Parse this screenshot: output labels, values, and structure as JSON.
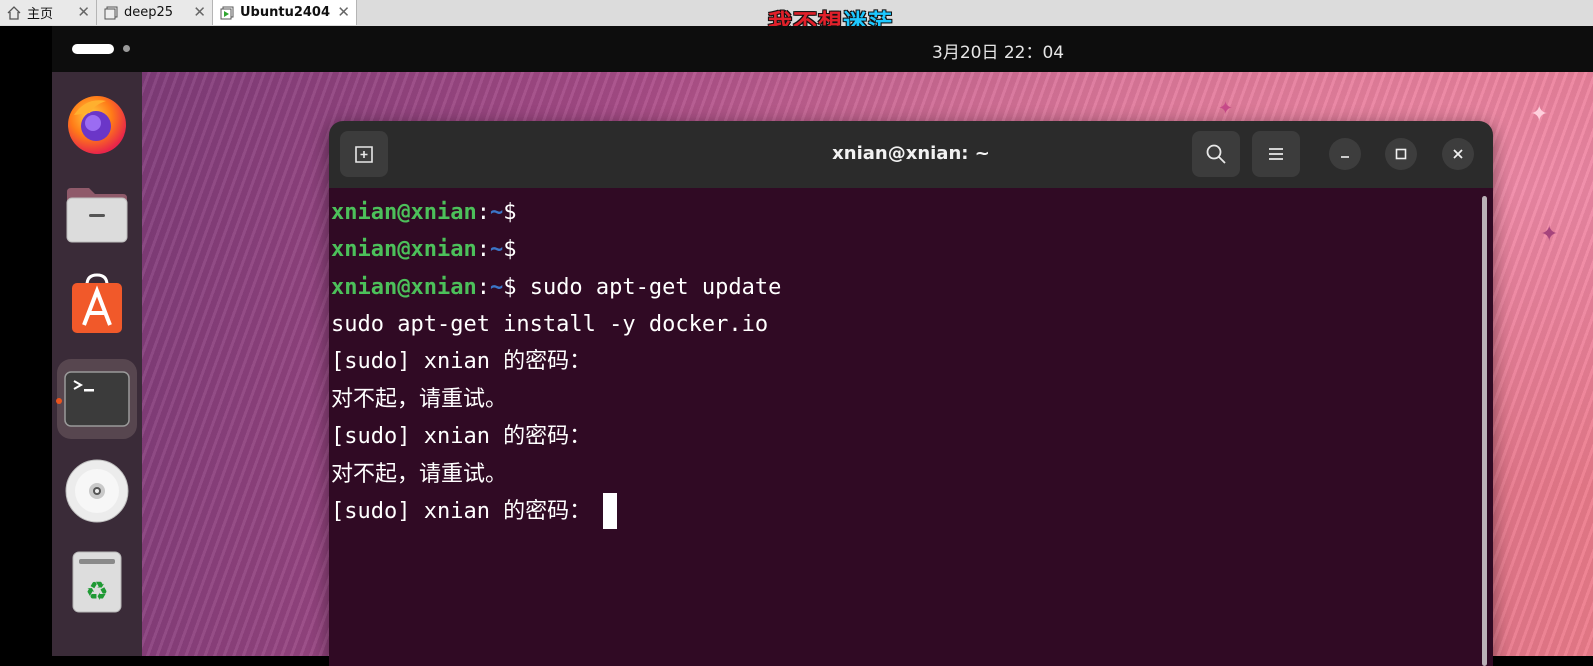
{
  "vm_tabs": [
    {
      "label": "主页",
      "icon": "home-icon"
    },
    {
      "label": "deep25",
      "icon": "vm-icon"
    },
    {
      "label": "Ubuntu2404",
      "icon": "vm-running-icon"
    }
  ],
  "banner": {
    "part1": "我不想",
    "part2": "迷茫"
  },
  "topbar": {
    "clock": "3月20日  22：04"
  },
  "dock": {
    "items": [
      "firefox-icon",
      "files-icon",
      "app-center-icon",
      "terminal-icon",
      "disc-icon",
      "trash-icon"
    ]
  },
  "terminal": {
    "title": "xnian@xnian: ~",
    "prompt_user": "xnian@xnian",
    "prompt_sep": ":",
    "prompt_path": "~",
    "prompt_dollar": "$",
    "cmd1": " sudo apt-get update",
    "cmd2": "sudo apt-get install -y docker.io",
    "sudo_prompt": "[sudo] xnian 的密码：",
    "retry": "对不起，请重试。"
  },
  "colors": {
    "terminal_bg": "#300a24",
    "prompt_user": "#4cc05a",
    "prompt_path": "#3b76c8",
    "dock_bg": "#3a2b38"
  }
}
